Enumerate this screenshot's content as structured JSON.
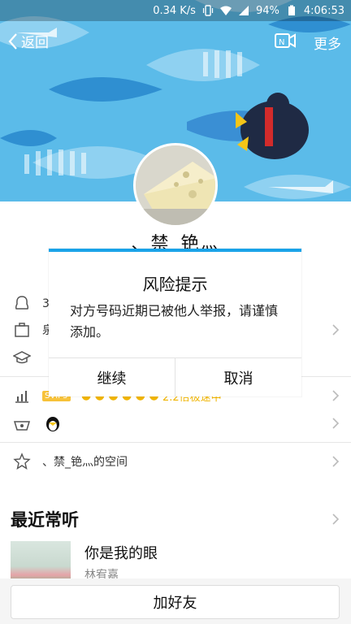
{
  "status_bar": {
    "speed": "0.34 K/s",
    "battery": "94%",
    "time": "4:06:53"
  },
  "topbar": {
    "back_label": "返回",
    "more_label": "更多"
  },
  "profile": {
    "nickname": "、禁_铯灬"
  },
  "rows": {
    "qq_partial": "3",
    "work_partial": "泉",
    "level_badge": "SVIP5",
    "level_text": "2.2倍极速中",
    "space_label": "、禁_铯灬的空间"
  },
  "music": {
    "section_title": "最近常听",
    "song_title": "你是我的眼",
    "song_artist": "林宥嘉"
  },
  "bottom": {
    "add_friend_label": "加好友"
  },
  "dialog": {
    "title": "风险提示",
    "message": "对方号码近期已被他人举报，请谨慎添加。",
    "continue_label": "继续",
    "cancel_label": "取消"
  },
  "colors": {
    "accent": "#1aa3e8",
    "banner_sky": "#4fb6ea"
  }
}
